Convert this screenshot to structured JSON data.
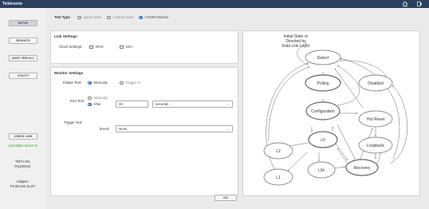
{
  "app": {
    "logo": "Tektronix"
  },
  "toolbar": {
    "icons": [
      "home-icon",
      "exit-icon"
    ]
  },
  "sidebar": {
    "buttons": [
      {
        "label": "SETUP",
        "active": true
      },
      {
        "label": "RESULTS",
        "active": false
      },
      {
        "label": "SAVE / RECALL",
        "active": false
      },
      {
        "label": "UTILITY",
        "active": false
      }
    ],
    "check_link_label": "CHECK LINK",
    "link_state": "Link State: Gen4 x4",
    "link_state_color": "#2e9a1f",
    "serial_label": "TMT4 SN:",
    "serial_value": "PQ100012",
    "adapter_label": "Adapter:",
    "adapter_value": "PCIE4-M2 SLOT"
  },
  "test_type": {
    "label": "Test Type",
    "options": [
      {
        "label": "Quick Scan",
        "selected": false
      },
      {
        "label": "Custom Scan",
        "selected": false
      },
      {
        "label": "LTSSM Monitor",
        "selected": true
      }
    ]
  },
  "link_settings": {
    "title": "Link Settings",
    "clock_label": "Clock Settings:",
    "options": [
      {
        "label": "SRIS",
        "checked": false
      },
      {
        "label": "SSC",
        "checked": false
      }
    ]
  },
  "monitor_settings": {
    "title": "Monitor Settings",
    "initiate_label": "Initiate Test:",
    "initiate_options": [
      {
        "label": "Manually",
        "selected": true
      },
      {
        "label": "Trigger In",
        "selected": false
      }
    ],
    "end_label": "End Test:",
    "end_options": [
      {
        "label": "Manually",
        "selected": false
      },
      {
        "label": "After",
        "selected": true
      }
    ],
    "end_value": "30",
    "end_unit": "seconds",
    "trigger_out_label": "Trigger Out:",
    "event_label": "Event:",
    "event_value": "None"
  },
  "diagram": {
    "caption": [
      "Initial State or",
      "Directed by",
      "Data Link Layer"
    ],
    "states": [
      "Detect",
      "Polling",
      "Disabled",
      "Configuration",
      "Hot Reset",
      "L2",
      "L0",
      "Loopback",
      "L1",
      "L0s",
      "Recovery"
    ]
  },
  "go_button": "GO"
}
